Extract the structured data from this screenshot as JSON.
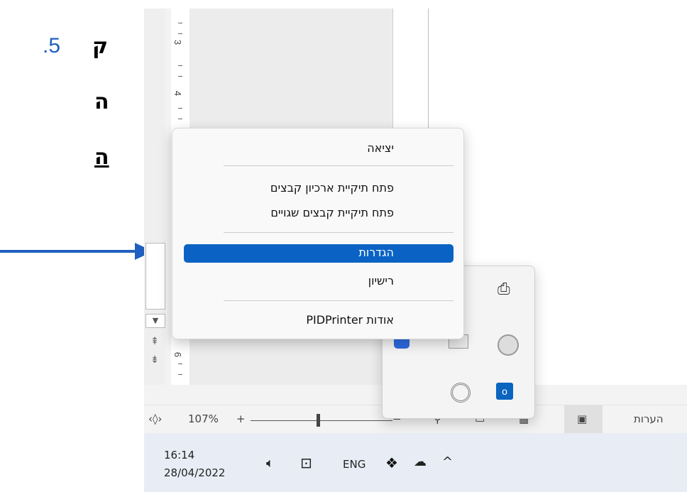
{
  "instruction": {
    "step_number": ".5",
    "line1_char": "ק",
    "line2_char": "ה",
    "line3_char": "ה"
  },
  "ruler": {
    "labels": [
      "3",
      "4",
      "6"
    ]
  },
  "context_menu": {
    "items": [
      {
        "label": "יציאה"
      },
      {
        "label": "פתח תיקיית ארכיון קבצים"
      },
      {
        "label": "פתח תיקיית קבצים שגויים"
      },
      {
        "label": "הגדרות",
        "highlighted": true
      },
      {
        "label": "רישיון"
      },
      {
        "label": "אודות PIDPrinter"
      }
    ]
  },
  "status_bar": {
    "zoom_level": "107%",
    "plus": "+",
    "minus": "−",
    "comments_label": "הערות"
  },
  "taskbar": {
    "time": "16:14",
    "date": "28/04/2022",
    "language": "ENG",
    "chevron": "^"
  },
  "colors": {
    "accent": "#0a63c4",
    "arrow": "#1f5fbf"
  }
}
